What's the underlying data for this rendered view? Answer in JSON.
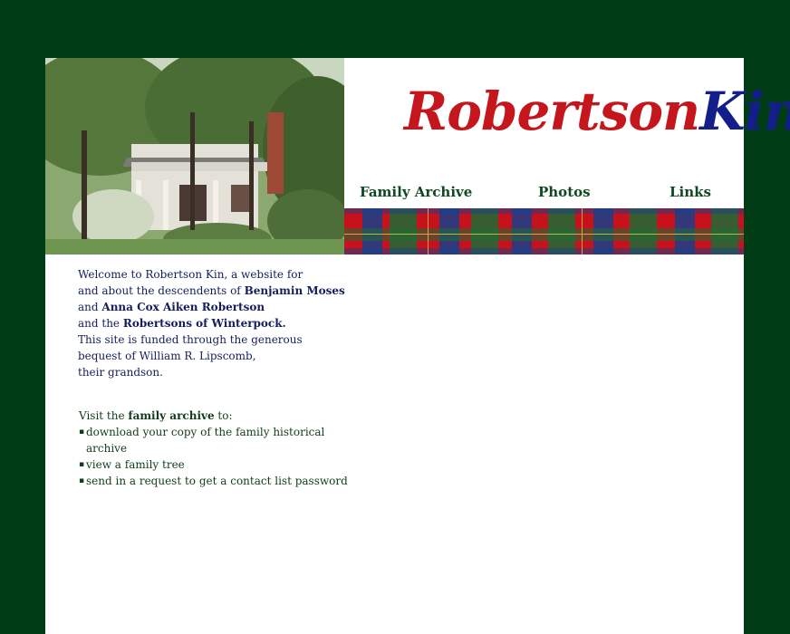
{
  "site": {
    "logo_part1": "Robertson",
    "logo_part2": "Kin"
  },
  "nav": {
    "family_archive": "Family Archive",
    "photos": "Photos",
    "links": "Links"
  },
  "intro": {
    "t1": "Welcome to Robertson Kin, a website for",
    "t2": "and about the descendents of ",
    "name1": "Benjamin Moses",
    "t3": " and ",
    "name2": "Anna Cox Aiken Robertson",
    "t4": "and the ",
    "name3": "Robertsons of Winterpock.",
    "t5": "This site is funded through the generous",
    "t6": "bequest of  William R. Lipscomb,",
    "t7": "their grandson."
  },
  "visit": {
    "t1": "Visit the ",
    "link": "family archive",
    "t2": " to:",
    "items": [
      "download your copy of the family historical archive",
      "view a family tree",
      "send in a request to get a contact list password"
    ]
  },
  "colors": {
    "background": "#003d17",
    "logo_red": "#c4161c",
    "logo_blue": "#141e8a",
    "nav_green": "#0f4a1e"
  }
}
